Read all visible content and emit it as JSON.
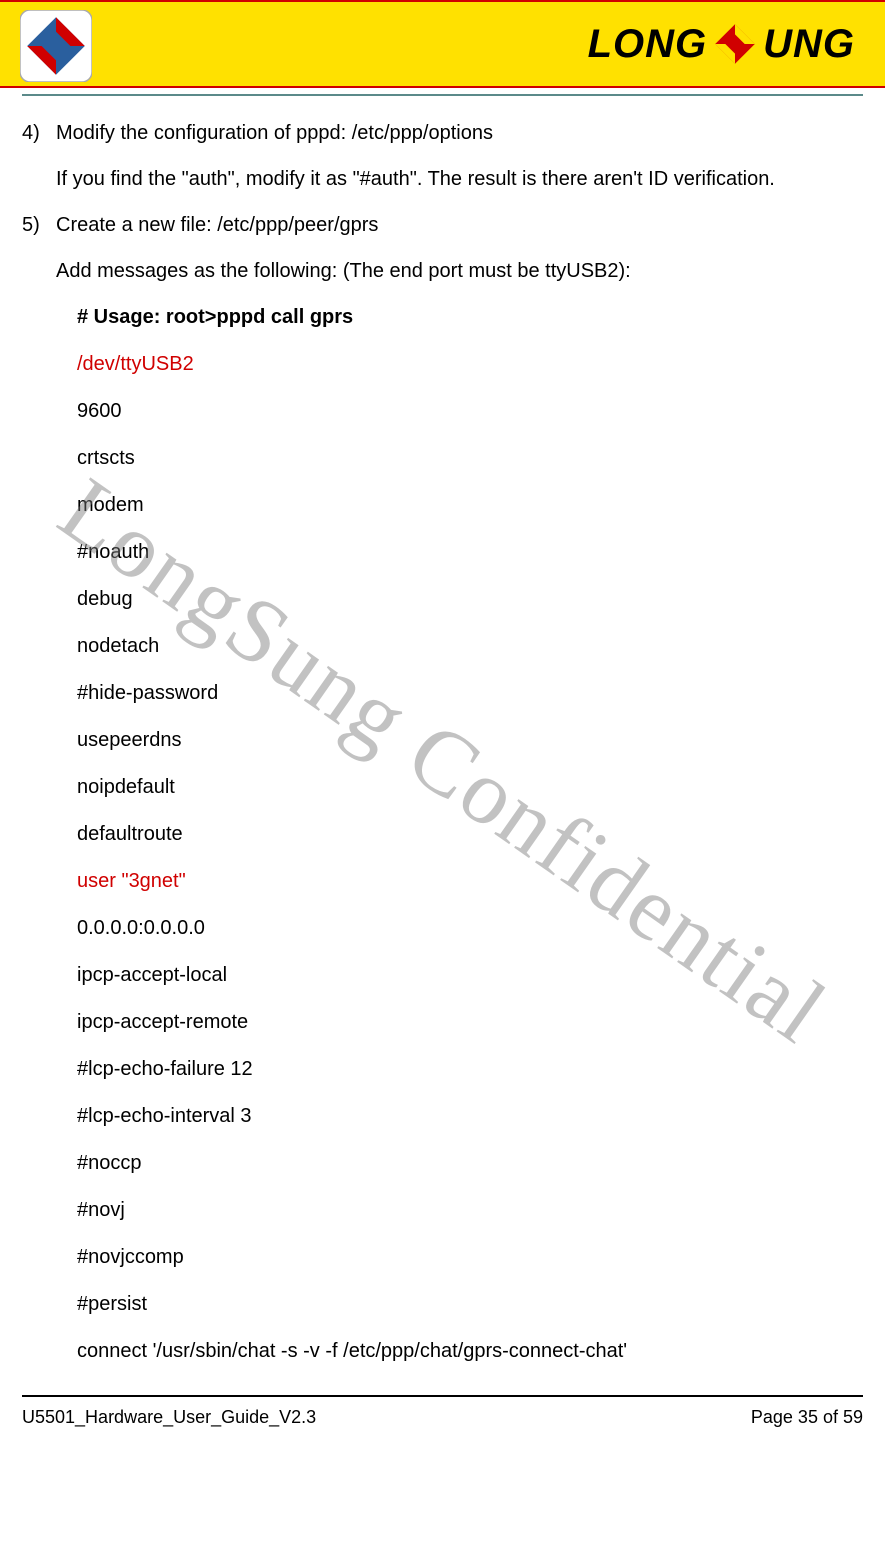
{
  "header": {
    "brand_left": "LONG",
    "brand_right": "UNG"
  },
  "watermark": "LongSung Confidential",
  "step4": {
    "num": "4)",
    "title": "Modify the configuration of pppd: /etc/ppp/options",
    "desc": "If you find the \"auth\", modify it as \"#auth\". The result is there aren't ID verification."
  },
  "step5": {
    "num": "5)",
    "title": "Create a new file: /etc/ppp/peer/gprs",
    "intro": "Add messages as the following: (The end port must be ttyUSB2):",
    "usage": "# Usage: root>pppd call gprs",
    "lines": [
      {
        "text": "/dev/ttyUSB2",
        "red": true
      },
      {
        "text": "9600"
      },
      {
        "text": "crtscts"
      },
      {
        "text": "modem"
      },
      {
        "text": "#noauth"
      },
      {
        "text": "debug"
      },
      {
        "text": "nodetach"
      },
      {
        "text": "#hide-password"
      },
      {
        "text": "usepeerdns"
      },
      {
        "text": "noipdefault"
      },
      {
        "text": "defaultroute"
      },
      {
        "text": "user \"3gnet\"",
        "red": true
      },
      {
        "text": "0.0.0.0:0.0.0.0"
      },
      {
        "text": "ipcp-accept-local"
      },
      {
        "text": "ipcp-accept-remote"
      },
      {
        "text": "#lcp-echo-failure   12"
      },
      {
        "text": "#lcp-echo-interval 3"
      },
      {
        "text": "#noccp"
      },
      {
        "text": "#novj"
      },
      {
        "text": "#novjccomp"
      },
      {
        "text": "#persist"
      },
      {
        "text": "connect '/usr/sbin/chat -s -v -f /etc/ppp/chat/gprs-connect-chat'"
      }
    ]
  },
  "footer": {
    "doc": "U5501_Hardware_User_Guide_V2.3",
    "page": "Page 35 of 59"
  }
}
